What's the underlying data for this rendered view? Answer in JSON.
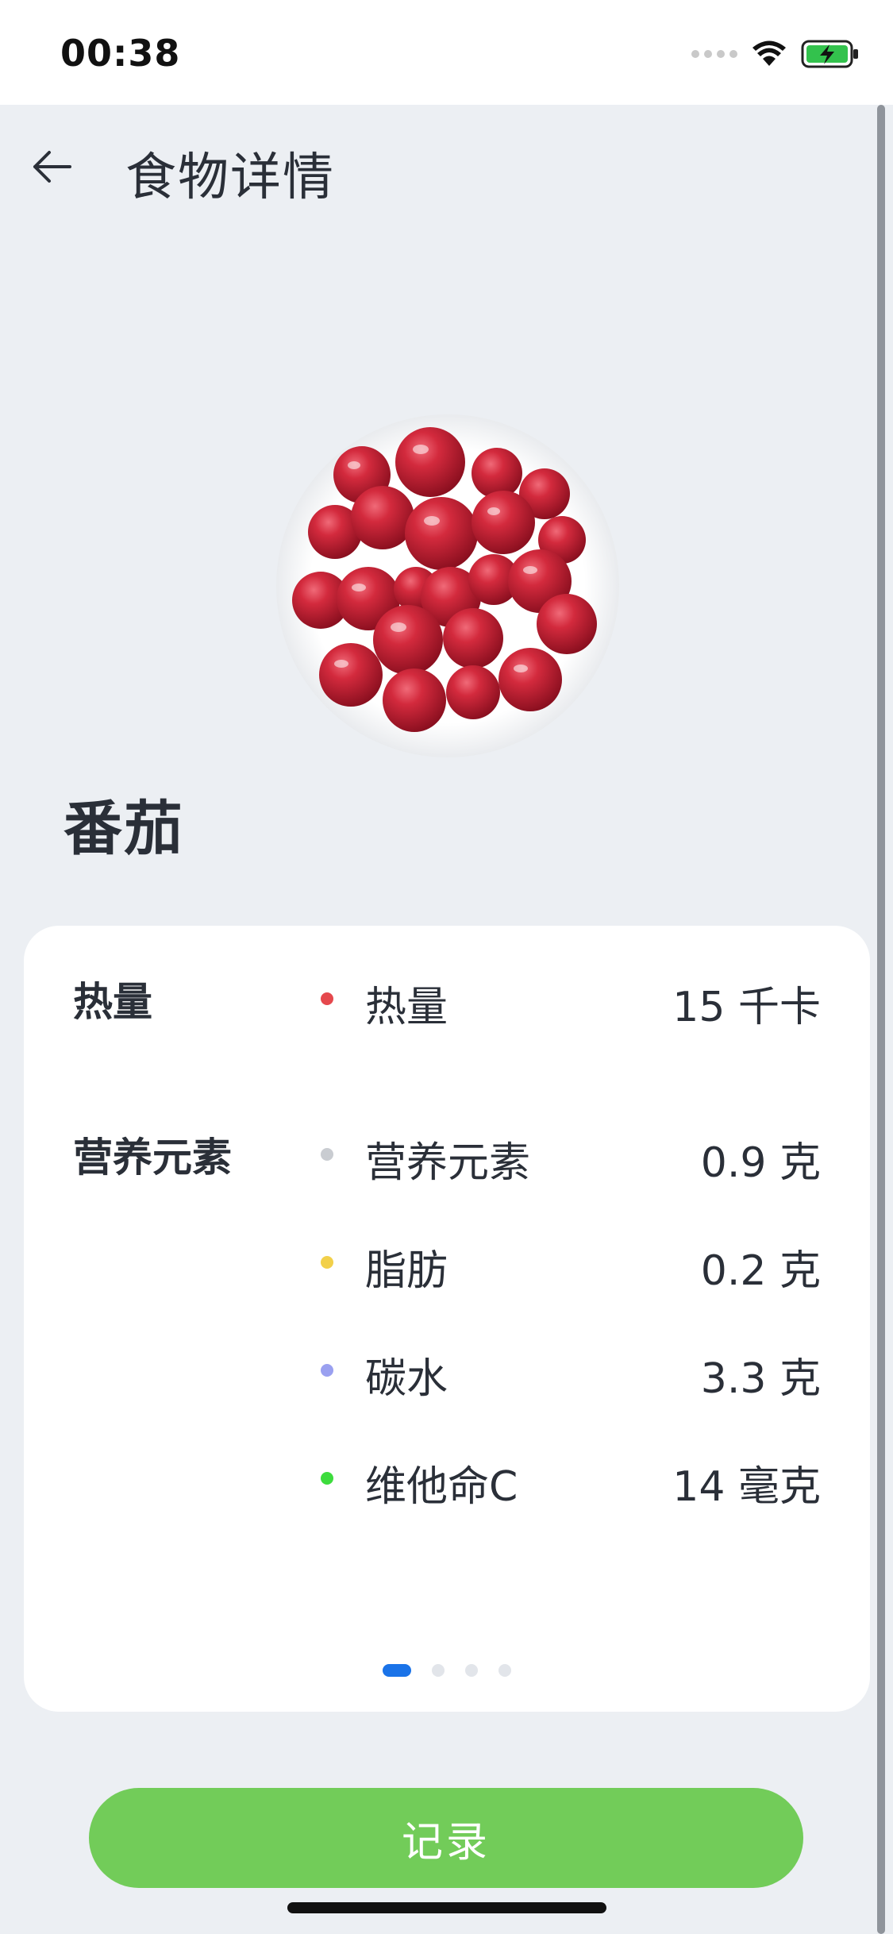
{
  "status_bar": {
    "time": "00:38"
  },
  "nav": {
    "title": "食物详情"
  },
  "food": {
    "name": "番茄"
  },
  "nutrition": {
    "sections": [
      {
        "label": "热量",
        "items": [
          {
            "name": "热量",
            "value": "15 千卡",
            "color": "#e5484d"
          }
        ]
      },
      {
        "label": "营养元素",
        "items": [
          {
            "name": "营养元素",
            "value": "0.9 克",
            "color": "#c9ccd1"
          },
          {
            "name": "脂肪",
            "value": "0.2 克",
            "color": "#f2d04a"
          },
          {
            "name": "碳水",
            "value": "3.3 克",
            "color": "#9aa0f0"
          },
          {
            "name": "维他命C",
            "value": "14 毫克",
            "color": "#3ddc3d"
          }
        ]
      }
    ]
  },
  "pager": {
    "count": 4,
    "active_index": 0
  },
  "actions": {
    "record_label": "记录"
  },
  "colors": {
    "accent": "#1a73e8",
    "record_button": "#72cc59",
    "background": "#eceff3"
  }
}
